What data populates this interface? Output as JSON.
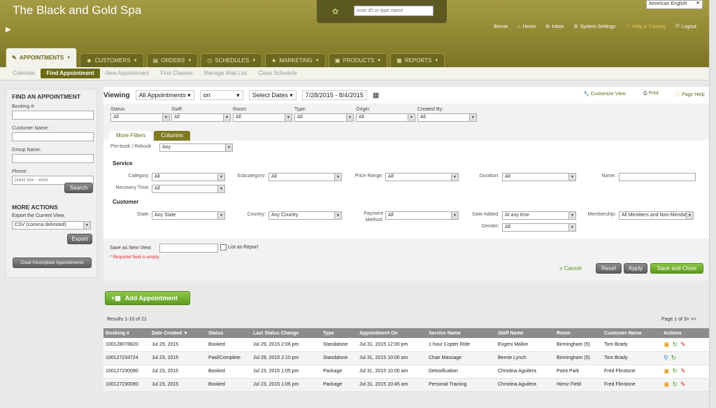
{
  "header": {
    "brand": "The Black and Gold Spa",
    "scan_placeholder": "scan ID or type name",
    "language": "American English",
    "nav": {
      "user": "Bernie",
      "home": "Home",
      "inbox": "Inbox",
      "system_settings": "System Settings",
      "help": "Help & Training",
      "logout": "Logout"
    }
  },
  "tabs": [
    "APPOINTMENTS",
    "CUSTOMERS",
    "ORDERS",
    "SCHEDULES",
    "MARKETING",
    "PRODUCTS",
    "REPORTS"
  ],
  "subnav": [
    "Calendar",
    "Find Appointment",
    "New Appointment",
    "Find Classes",
    "Manage Wait List",
    "Class Schedule"
  ],
  "sidebar": {
    "title": "FIND AN APPOINTMENT",
    "booking_label": "Booking #:",
    "customer_label": "Customer Name:",
    "group_label": "Group Name:",
    "phone_label": "Phone:",
    "phone_placeholder": "(xxx) xxx - xxxx",
    "search": "Search",
    "more_actions": "MORE ACTIONS",
    "export_label": "Export the Current View:",
    "export_format": "CSV (comma delimited)",
    "export": "Export",
    "clear": "Clear Incomplete Appointments"
  },
  "viewbar": {
    "viewing": "Viewing",
    "view": "All Appointments",
    "on": "on",
    "select_dates": "Select Dates",
    "range": "7/28/2015 - 8/4/2015",
    "customize": "Customize View",
    "print": "Print",
    "page_help": "Page Help"
  },
  "filters": [
    {
      "label": "Status:",
      "value": "All"
    },
    {
      "label": "Staff:",
      "value": "All"
    },
    {
      "label": "Room:",
      "value": "All"
    },
    {
      "label": "Type:",
      "value": "All"
    },
    {
      "label": "Origin:",
      "value": "All"
    },
    {
      "label": "Created By:",
      "value": "All"
    }
  ],
  "filter_tabs": {
    "more": "More Filters",
    "columns": "Columns"
  },
  "adv": {
    "prebook_label": "Pre-book / Rebook:",
    "prebook": "Any",
    "service": "Service",
    "category_label": "Category:",
    "category": "All",
    "subcategory_label": "Subcategory:",
    "subcategory": "All",
    "price_label": "Price Range:",
    "price": "All",
    "duration_label": "Duration:",
    "duration": "All",
    "name_label": "Name:",
    "recovery_label": "Recovery Time:",
    "recovery": "All",
    "customer": "Customer",
    "state_label": "State:",
    "state": "Any State",
    "country_label": "Country:",
    "country": "Any Country",
    "payment_label": "Payment Method:",
    "payment": "All",
    "date_added_label": "Date Added:",
    "date_added": "At any time",
    "membership_label": "Membership:",
    "membership": "All Members and Non-Members",
    "gender_label": "Gender:",
    "gender": "All"
  },
  "saveview": {
    "label": "Save as New View:",
    "list_report": "List as Report",
    "required": "* Required field is empty.",
    "cancel": "Cancel",
    "reset": "Reset",
    "apply": "Apply",
    "save_close": "Save and Close"
  },
  "results": {
    "add": "Add Appointment",
    "count": "Results 1-10 of 21",
    "pager": "Page 1 of 3> >>",
    "columns": [
      "Booking #",
      "Date Created",
      "Status",
      "Last Status Change",
      "Type",
      "Appointment On",
      "Service Name",
      "Staff Name",
      "Room",
      "Customer Name",
      "Actions"
    ],
    "rows": [
      [
        "100128078820",
        "Jul 29, 2015",
        "Booked",
        "Jul 29, 2015 2:06 pm",
        "Standalone",
        "Jul 31, 2015 12:00 pm",
        "1 hour Copter Ride",
        "Evgeni Malkin",
        "Birmingham (5)",
        "Tom Brady"
      ],
      [
        "100127233724",
        "Jul 23, 2015",
        "Paid/Complete",
        "Jul 29, 2015 2:10 pm",
        "Standalone",
        "Jul 31, 2015 10:00 am",
        "Chair Massage",
        "Bernie Lynch",
        "Birmingham (5)",
        "Tom Brady"
      ],
      [
        "100127230090",
        "Jul 23, 2015",
        "Booked",
        "Jul 23, 2015 1:05 pm",
        "Package",
        "Jul 31, 2015 10:00 am",
        "Detoxification",
        "Christina Aguilera",
        "Point Park",
        "Fred Flinstone"
      ],
      [
        "100127230090",
        "Jul 23, 2015",
        "Booked",
        "Jul 23, 2015 1:05 pm",
        "Package",
        "Jul 31, 2015 10:45 am",
        "Personal Training",
        "Christina Aguilera",
        "Hienz Field",
        "Fred Flinstone"
      ]
    ]
  }
}
